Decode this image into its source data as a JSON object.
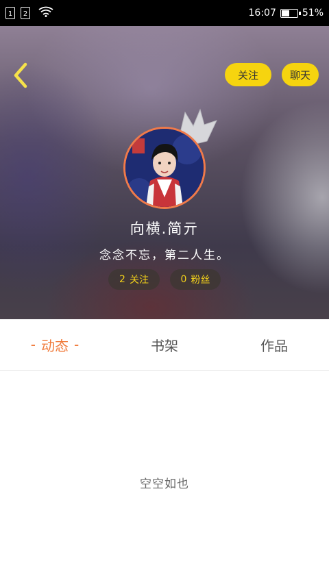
{
  "status_bar": {
    "sim1": "1",
    "sim2": "2",
    "time": "16:07",
    "battery_percent": "51%",
    "battery_level": 0.51
  },
  "header": {
    "follow_label": "关注",
    "chat_label": "聊天",
    "nickname": "向横.简亓",
    "signature": "念念不忘，第二人生。",
    "following_count": "2",
    "following_label": "关注",
    "fans_count": "0",
    "fans_label": "粉丝",
    "accent_color": "#f6d40f"
  },
  "tabs": [
    {
      "label": "动态",
      "active": true
    },
    {
      "label": "书架",
      "active": false
    },
    {
      "label": "作品",
      "active": false
    }
  ],
  "active_tab_decoration": "-",
  "empty_state": "空空如也",
  "colors": {
    "active_tab": "#f07a3a",
    "stat_text": "#f3d21a",
    "avatar_border": "#f07a4a"
  }
}
